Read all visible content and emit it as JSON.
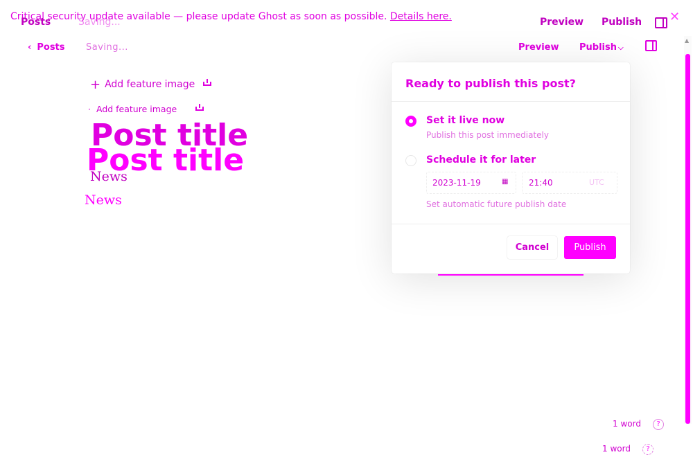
{
  "banner": {
    "text": "Critical security update available — please update Ghost as soon as possible.",
    "link": "Details here."
  },
  "ghost_header": {
    "back": "Posts",
    "status": "Saving...",
    "preview": "Preview",
    "publish": "Publish"
  },
  "header": {
    "back_label": "Posts",
    "status": "Saving...",
    "preview_label": "Preview",
    "publish_label": "Publish"
  },
  "editor": {
    "feature_image_label": "Add feature image",
    "title": "Post title",
    "body": "News"
  },
  "footer": {
    "word_count": "1 word",
    "help_glyph": "?"
  },
  "publish_menu": {
    "title": "Ready to publish this post?",
    "options": [
      {
        "label": "Set it live now",
        "description": "Publish this post immediately",
        "selected": true
      },
      {
        "label": "Schedule it for later",
        "description": "Set automatic future publish date",
        "selected": false
      }
    ],
    "date": "2023-11-19",
    "time": "21:40",
    "timezone": "UTC",
    "cancel_label": "Cancel",
    "publish_label": "Publish"
  },
  "colors": {
    "accent": "#ff00ff",
    "background": "#ffffff"
  },
  "icons": {
    "back": "chevron-left-icon",
    "publish_dropdown": "chevron-down-icon",
    "sidebar": "sidebar-toggle-icon",
    "feature_add": "plus-icon",
    "upload": "upload-icon",
    "calendar": "calendar-icon",
    "help": "help-icon",
    "close": "close-icon"
  }
}
